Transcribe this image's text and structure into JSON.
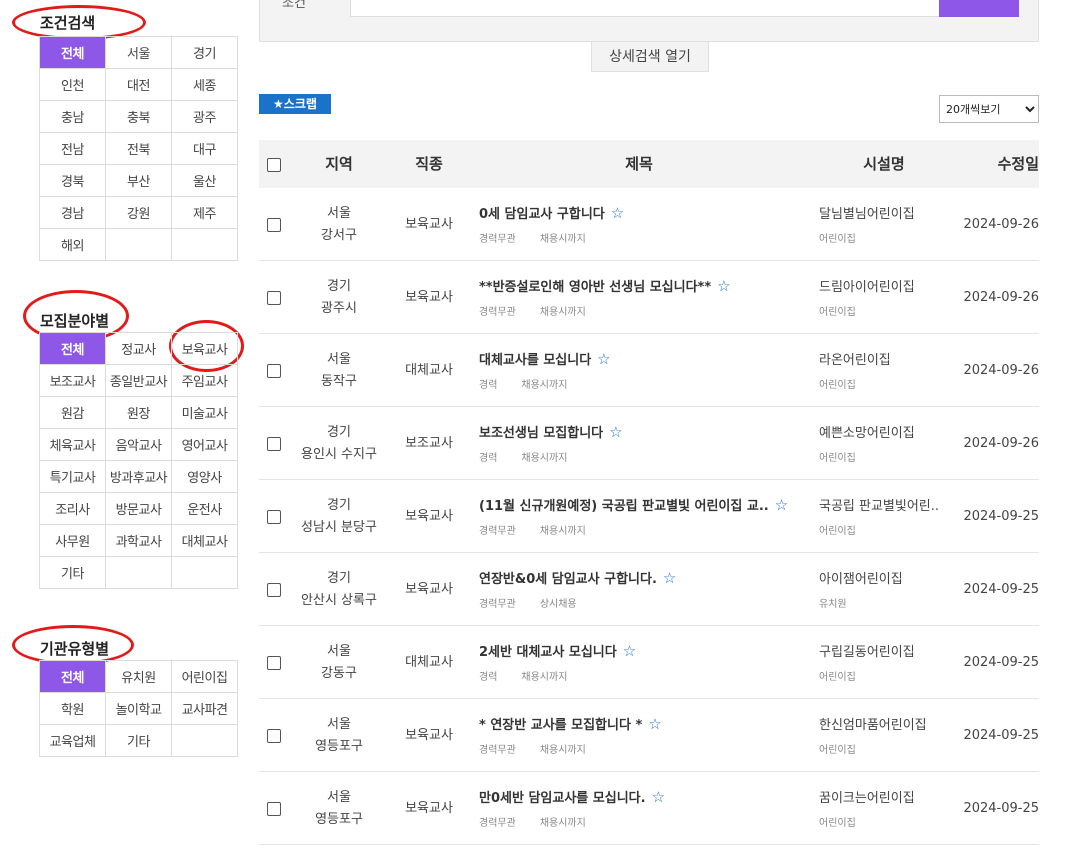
{
  "search": {
    "label": "조건",
    "detail_button": "상세검색 열기"
  },
  "scrap_label": "★스크랩",
  "view_select": {
    "selected": "20개씩보기"
  },
  "sections": {
    "region": {
      "title": "조건검색",
      "cells": [
        "전체",
        "서울",
        "경기",
        "인천",
        "대전",
        "세종",
        "충남",
        "충북",
        "광주",
        "전남",
        "전북",
        "대구",
        "경북",
        "부산",
        "울산",
        "경남",
        "강원",
        "제주",
        "해외",
        "",
        ""
      ],
      "active_index": 0
    },
    "field": {
      "title": "모집분야별",
      "cells": [
        "전체",
        "정교사",
        "보육교사",
        "보조교사",
        "종일반교사",
        "주임교사",
        "원감",
        "원장",
        "미술교사",
        "체육교사",
        "음악교사",
        "영어교사",
        "특기교사",
        "방과후교사",
        "영양사",
        "조리사",
        "방문교사",
        "운전사",
        "사무원",
        "과학교사",
        "대체교사",
        "기타",
        "",
        ""
      ],
      "active_index": 0
    },
    "org": {
      "title": "기관유형별",
      "cells": [
        "전체",
        "유치원",
        "어린이집",
        "학원",
        "놀이학교",
        "교사파견",
        "교육업체",
        "기타",
        ""
      ],
      "active_index": 0
    }
  },
  "table": {
    "headers": {
      "region": "지역",
      "job": "직종",
      "title": "제목",
      "facility": "시설명",
      "date": "수정일"
    },
    "rows": [
      {
        "region1": "서울",
        "region2": "강서구",
        "job": "보육교사",
        "title": "0세 담임교사 구합니다",
        "meta1": "경력무관",
        "meta2": "채용시까지",
        "facility": "달님별님어린이집",
        "facility_type": "어린이집",
        "date": "2024-09-26"
      },
      {
        "region1": "경기",
        "region2": "광주시",
        "job": "보육교사",
        "title": "**반증설로인해 영아반 선생님 모십니다**",
        "meta1": "경력무관",
        "meta2": "채용시까지",
        "facility": "드림아이어린이집",
        "facility_type": "어린이집",
        "date": "2024-09-26"
      },
      {
        "region1": "서울",
        "region2": "동작구",
        "job": "대체교사",
        "title": "대체교사를 모십니다",
        "meta1": "경력",
        "meta2": "채용시까지",
        "facility": "라온어린이집",
        "facility_type": "어린이집",
        "date": "2024-09-26"
      },
      {
        "region1": "경기",
        "region2": "용인시 수지구",
        "job": "보조교사",
        "title": "보조선생님 모집합니다",
        "meta1": "경력",
        "meta2": "채용시까지",
        "facility": "예쁜소망어린이집",
        "facility_type": "어린이집",
        "date": "2024-09-26"
      },
      {
        "region1": "경기",
        "region2": "성남시 분당구",
        "job": "보육교사",
        "title": "(11월 신규개원예정) 국공립 판교별빛 어린이집 교..",
        "meta1": "경력무관",
        "meta2": "채용시까지",
        "facility": "국공립 판교별빛어린..",
        "facility_type": "어린이집",
        "date": "2024-09-25"
      },
      {
        "region1": "경기",
        "region2": "안산시 상록구",
        "job": "보육교사",
        "title": "연장반&0세 담임교사 구합니다.",
        "meta1": "경력무관",
        "meta2": "상시채용",
        "facility": "아이잼어린이집",
        "facility_type": "유치원",
        "date": "2024-09-25"
      },
      {
        "region1": "서울",
        "region2": "강동구",
        "job": "대체교사",
        "title": "2세반 대체교사 모십니다",
        "meta1": "경력",
        "meta2": "채용시까지",
        "facility": "구립길동어린이집",
        "facility_type": "어린이집",
        "date": "2024-09-25"
      },
      {
        "region1": "서울",
        "region2": "영등포구",
        "job": "보육교사",
        "title": "* 연장반 교사를 모집합니다 *",
        "meta1": "경력무관",
        "meta2": "채용시까지",
        "facility": "한신엄마품어린이집",
        "facility_type": "어린이집",
        "date": "2024-09-25"
      },
      {
        "region1": "서울",
        "region2": "영등포구",
        "job": "보육교사",
        "title": "만0세반 담임교사를 모십니다.",
        "meta1": "경력무관",
        "meta2": "채용시까지",
        "facility": "꿈이크는어린이집",
        "facility_type": "어린이집",
        "date": "2024-09-25"
      }
    ]
  },
  "colors": {
    "accent": "#8e57e8",
    "scrap": "#1a73c8",
    "annotation": "#e21a1a"
  }
}
